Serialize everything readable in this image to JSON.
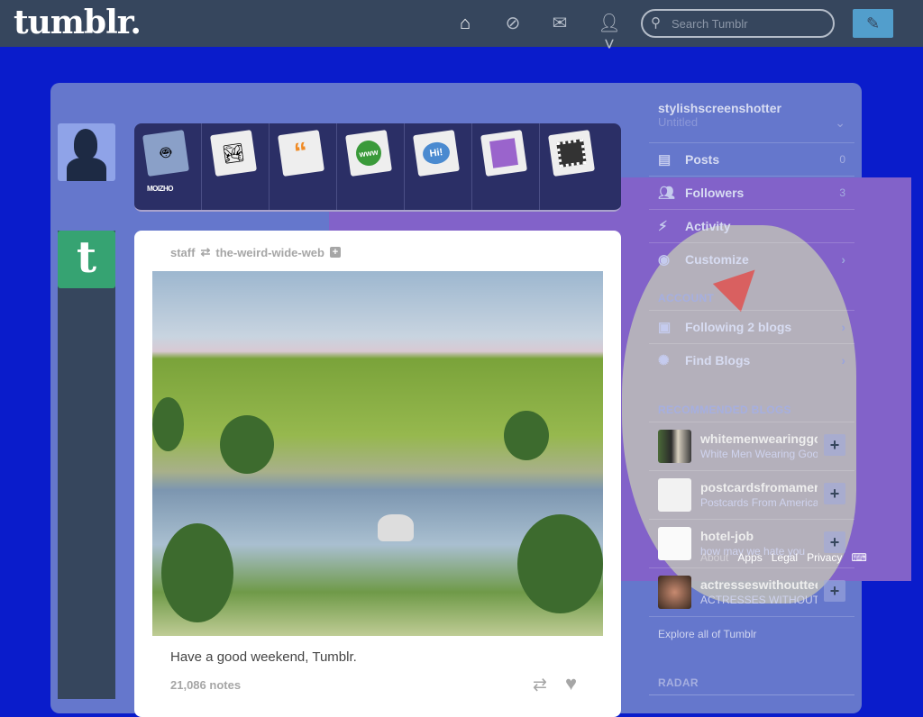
{
  "header": {
    "logo": "tumblr.",
    "search_placeholder": "Search Tumblr",
    "nav_icons": [
      "home-icon",
      "explore-compass-icon",
      "inbox-envelope-icon",
      "account-icon"
    ],
    "compose_icon": "pencil-icon"
  },
  "colors": {
    "header_bg": "#36465d",
    "page_bg": "#0a1ccb",
    "panel_bg": "#6577cc",
    "compose": "#529ecc",
    "tumblr_green": "#36a372"
  },
  "post_types": [
    {
      "name": "text",
      "label": "MOIZHO"
    },
    {
      "name": "photo"
    },
    {
      "name": "quote"
    },
    {
      "name": "link"
    },
    {
      "name": "chat"
    },
    {
      "name": "audio"
    },
    {
      "name": "video"
    }
  ],
  "post": {
    "author": "staff",
    "reblogged_from": "the-weird-wide-web",
    "caption": "Have a good weekend, Tumblr.",
    "notes": "21,086 notes"
  },
  "sidebar": {
    "blog_name": "stylishscreenshotter",
    "blog_title": "Untitled",
    "items": [
      {
        "label": "Posts",
        "count": "0",
        "icon": "posts-icon"
      },
      {
        "label": "Followers",
        "count": "3",
        "icon": "followers-icon"
      },
      {
        "label": "Activity",
        "icon": "lightning-icon"
      },
      {
        "label": "Customize",
        "icon": "eye-icon"
      }
    ],
    "account_header": "ACCOUNT",
    "account_items": [
      {
        "label": "Following 2 blogs",
        "icon": "following-icon"
      },
      {
        "label": "Find Blogs",
        "icon": "find-blogs-icon"
      }
    ],
    "recommended_header": "RECOMMENDED BLOGS",
    "recommended": [
      {
        "name": "whitemenwearinggoogleglass",
        "desc": "White Men Wearing Google Glass"
      },
      {
        "name": "postcardsfromamerica",
        "desc": "Postcards From America"
      },
      {
        "name": "hotel-job",
        "desc": "how may we hate you"
      },
      {
        "name": "actresseswithoutteeth",
        "desc": "ACTRESSES WITHOUT TEETH"
      }
    ],
    "explore": "Explore all of Tumblr",
    "radar_header": "RADAR"
  },
  "footer": {
    "links": [
      "About",
      "Apps",
      "Legal",
      "Privacy"
    ]
  }
}
